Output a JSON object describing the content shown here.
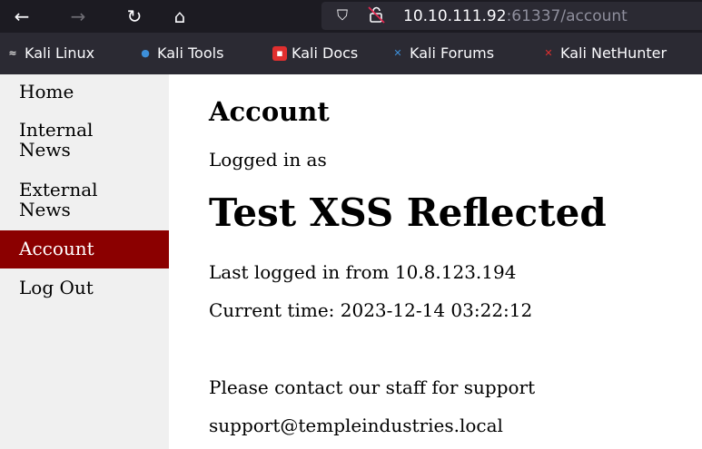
{
  "browser": {
    "url_host": "10.10.111.92",
    "url_rest": ":61337/account",
    "nav": {
      "back": "←",
      "forward": "→",
      "reload": "↻",
      "home": "⌂"
    },
    "url_icons": {
      "shield": "⛉",
      "insecure": "🔓"
    }
  },
  "bookmarks": [
    {
      "label": "Kali Linux",
      "icon": "kali-dragon-icon",
      "glyph": "≈",
      "color": "#e0e0e0"
    },
    {
      "label": "Kali Tools",
      "icon": "kali-tools-icon",
      "glyph": "●",
      "color": "#3d8fd9"
    },
    {
      "label": "Kali Docs",
      "icon": "kali-docs-icon",
      "glyph": "▪",
      "color": "#e02f2f"
    },
    {
      "label": "Kali Forums",
      "icon": "kali-forums-icon",
      "glyph": "✕",
      "color": "#3d8fd9"
    },
    {
      "label": "Kali NetHunter",
      "icon": "kali-nethunter-icon",
      "glyph": "✕",
      "color": "#e02f2f"
    }
  ],
  "sidebar": {
    "items": [
      {
        "label": "Home"
      },
      {
        "label": "Internal\nNews"
      },
      {
        "label": "External\nNews"
      },
      {
        "label": "Account"
      },
      {
        "label": "Log Out"
      }
    ],
    "active_color": "#8b0000"
  },
  "main": {
    "heading": "Account",
    "logged_in_label": "Logged in as",
    "username": "Test XSS Reflected",
    "last_login": "Last logged in from 10.8.123.194",
    "current_time": "Current time: 2023-12-14 03:22:12",
    "support_text": "Please contact our staff for support",
    "support_email": "support@templeindustries.local"
  }
}
